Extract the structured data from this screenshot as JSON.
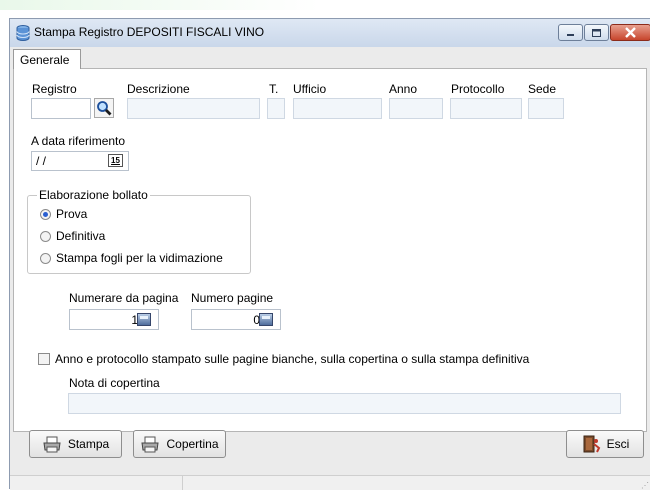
{
  "window": {
    "title": "Stampa Registro DEPOSITI FISCALI VINO"
  },
  "tabs": [
    {
      "label": "Generale"
    }
  ],
  "fields": {
    "registro": {
      "label": "Registro",
      "value": ""
    },
    "descrizione": {
      "label": "Descrizione",
      "value": ""
    },
    "t": {
      "label": "T.",
      "value": ""
    },
    "ufficio": {
      "label": "Ufficio",
      "value": ""
    },
    "anno": {
      "label": "Anno",
      "value": ""
    },
    "protocollo": {
      "label": "Protocollo",
      "value": ""
    },
    "sede": {
      "label": "Sede",
      "value": ""
    },
    "data_riferimento": {
      "label": "A data riferimento",
      "value": "/ /",
      "calendar_glyph": "15"
    }
  },
  "elaborazione": {
    "title": "Elaborazione bollato",
    "options": [
      {
        "label": "Prova",
        "selected": true
      },
      {
        "label": "Definitiva",
        "selected": false
      },
      {
        "label": "Stampa fogli per la vidimazione",
        "selected": false
      }
    ]
  },
  "numerazione": {
    "da_pagina": {
      "label": "Numerare da pagina",
      "value": "1"
    },
    "numero_pagine": {
      "label": "Numero pagine",
      "value": "0"
    }
  },
  "checkbox_anno": {
    "label": "Anno e protocollo stampato sulle pagine bianche, sulla copertina o sulla stampa definitiva",
    "checked": false
  },
  "nota": {
    "label": "Nota di copertina",
    "value": ""
  },
  "buttons": {
    "stampa": "Stampa",
    "copertina": "Copertina",
    "esci": "Esci"
  },
  "icons": {
    "title": "database-icon",
    "search": "search-icon",
    "calendar": "calendar-icon",
    "calculator": "calculator-icon",
    "printer": "printer-icon",
    "exit": "exit-icon"
  },
  "colors": {
    "radio_selected": "#2a5fd1",
    "close_button": "#c7452c",
    "field_bg": "#f2f6fa"
  }
}
